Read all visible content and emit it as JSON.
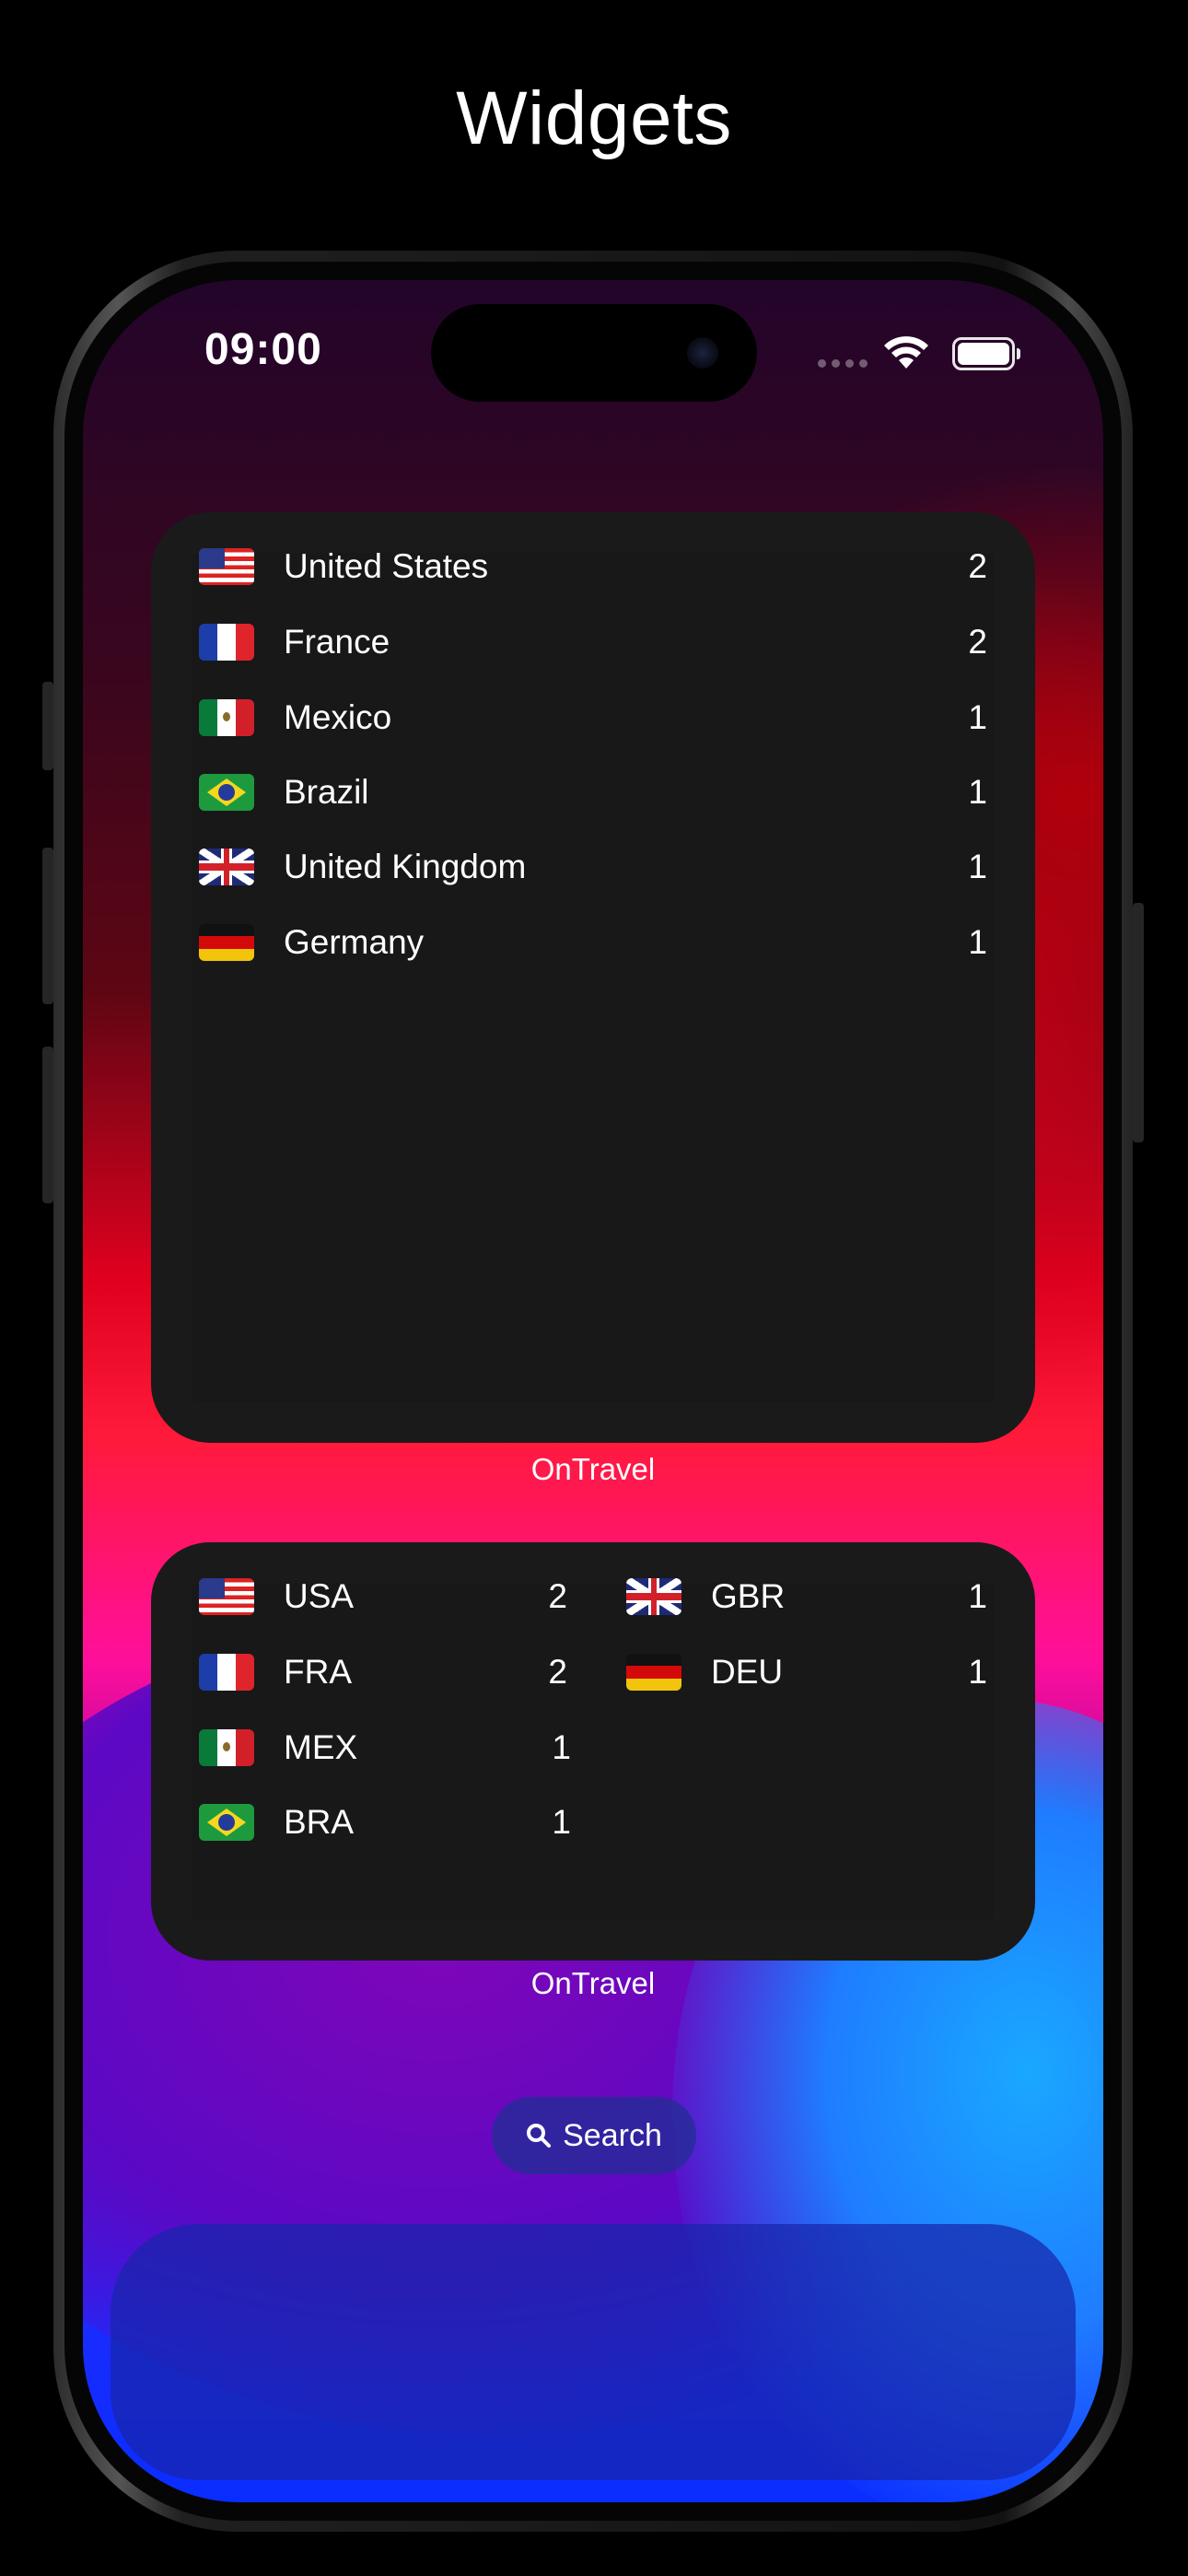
{
  "page_title": "Widgets",
  "status_bar": {
    "time": "09:00",
    "icons": [
      "signal-icon",
      "wifi-icon",
      "battery-icon"
    ]
  },
  "widget_large": {
    "rows": [
      {
        "flag": "us-flag-icon",
        "name": "United States",
        "count": "2"
      },
      {
        "flag": "fr-flag-icon",
        "name": "France",
        "count": "2"
      },
      {
        "flag": "mx-flag-icon",
        "name": "Mexico",
        "count": "1"
      },
      {
        "flag": "br-flag-icon",
        "name": "Brazil",
        "count": "1"
      },
      {
        "flag": "gb-flag-icon",
        "name": "United Kingdom",
        "count": "1"
      },
      {
        "flag": "de-flag-icon",
        "name": "Germany",
        "count": "1"
      }
    ],
    "caption": "OnTravel"
  },
  "widget_medium": {
    "left_column": [
      {
        "flag": "us-flag-icon",
        "code": "USA",
        "count": "2"
      },
      {
        "flag": "fr-flag-icon",
        "code": "FRA",
        "count": "2"
      },
      {
        "flag": "mx-flag-icon",
        "code": "MEX",
        "count": "1"
      },
      {
        "flag": "br-flag-icon",
        "code": "BRA",
        "count": "1"
      }
    ],
    "right_column": [
      {
        "flag": "gb-flag-icon",
        "code": "GBR",
        "count": "1"
      },
      {
        "flag": "de-flag-icon",
        "code": "DEU",
        "count": "1"
      }
    ],
    "caption": "OnTravel"
  },
  "search_button": {
    "label": "Search",
    "icon": "search-icon"
  }
}
